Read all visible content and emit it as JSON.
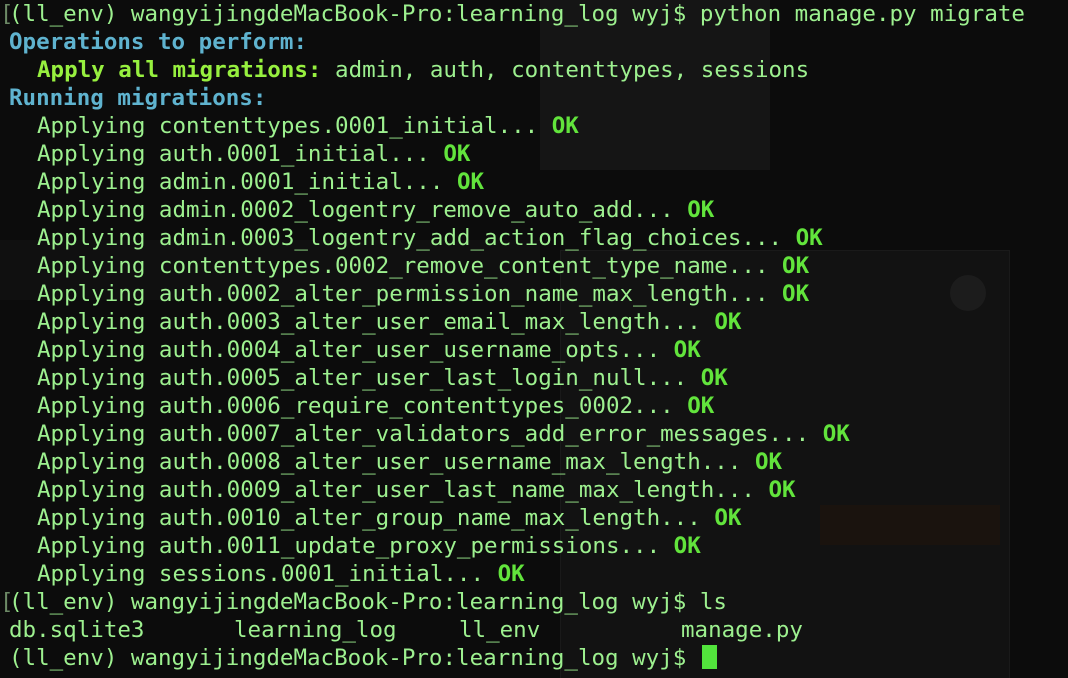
{
  "terminal": {
    "prompt": "(ll_env) wangyijingdeMacBook-Pro:learning_log wyj$",
    "command_migrate": "python manage.py migrate",
    "operations_header": "Operations to perform:",
    "apply_label": "Apply all migrations:",
    "apply_value": "admin, auth, contenttypes, sessions",
    "running_header": "Running migrations:",
    "migrations": [
      {
        "text": "Applying contenttypes.0001_initial...",
        "status": "OK"
      },
      {
        "text": "Applying auth.0001_initial...",
        "status": "OK"
      },
      {
        "text": "Applying admin.0001_initial...",
        "status": "OK"
      },
      {
        "text": "Applying admin.0002_logentry_remove_auto_add...",
        "status": "OK"
      },
      {
        "text": "Applying admin.0003_logentry_add_action_flag_choices...",
        "status": "OK"
      },
      {
        "text": "Applying contenttypes.0002_remove_content_type_name...",
        "status": "OK"
      },
      {
        "text": "Applying auth.0002_alter_permission_name_max_length...",
        "status": "OK"
      },
      {
        "text": "Applying auth.0003_alter_user_email_max_length...",
        "status": "OK"
      },
      {
        "text": "Applying auth.0004_alter_user_username_opts...",
        "status": "OK"
      },
      {
        "text": "Applying auth.0005_alter_user_last_login_null...",
        "status": "OK"
      },
      {
        "text": "Applying auth.0006_require_contenttypes_0002...",
        "status": "OK"
      },
      {
        "text": "Applying auth.0007_alter_validators_add_error_messages...",
        "status": "OK"
      },
      {
        "text": "Applying auth.0008_alter_user_username_max_length...",
        "status": "OK"
      },
      {
        "text": "Applying auth.0009_alter_user_last_name_max_length...",
        "status": "OK"
      },
      {
        "text": "Applying auth.0010_alter_group_name_max_length...",
        "status": "OK"
      },
      {
        "text": "Applying auth.0011_update_proxy_permissions...",
        "status": "OK"
      },
      {
        "text": "Applying sessions.0001_initial...",
        "status": "OK"
      }
    ],
    "command_ls": "ls",
    "ls_output": [
      "db.sqlite3",
      "learning_log",
      "ll_env",
      "manage.py"
    ]
  }
}
